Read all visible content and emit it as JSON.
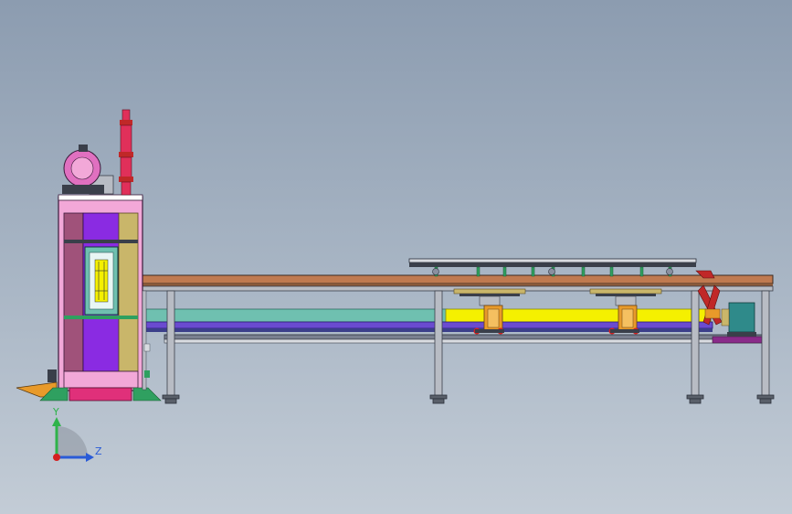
{
  "view": {
    "background_top": "#8c9cb0",
    "background_bottom": "#c3ccd6"
  },
  "triad": {
    "y_label": "Y",
    "z_label": "Z",
    "y_color": "#2fb34a",
    "z_color": "#2a5bd7",
    "origin_color": "#d42020"
  },
  "colors": {
    "press_magenta": "#d63f9c",
    "press_pink": "#f2a8d8",
    "press_purple": "#8a2be2",
    "press_mauve": "#a0527a",
    "press_khaki": "#c9b66a",
    "motor_pink": "#e070c0",
    "cylinder_red": "#e0305a",
    "table_brown": "#c07a50",
    "rail_yellow": "#f5f000",
    "rail_teal": "#6fc0b0",
    "rail_purple": "#6a4bd0",
    "frame_gray": "#b8bcc4",
    "frame_dark": "#3a3f4a",
    "clamp_orange": "#e89a2a",
    "motor_teal": "#2f8a8a",
    "arm_red": "#c02828",
    "base_green": "#2fa060"
  }
}
